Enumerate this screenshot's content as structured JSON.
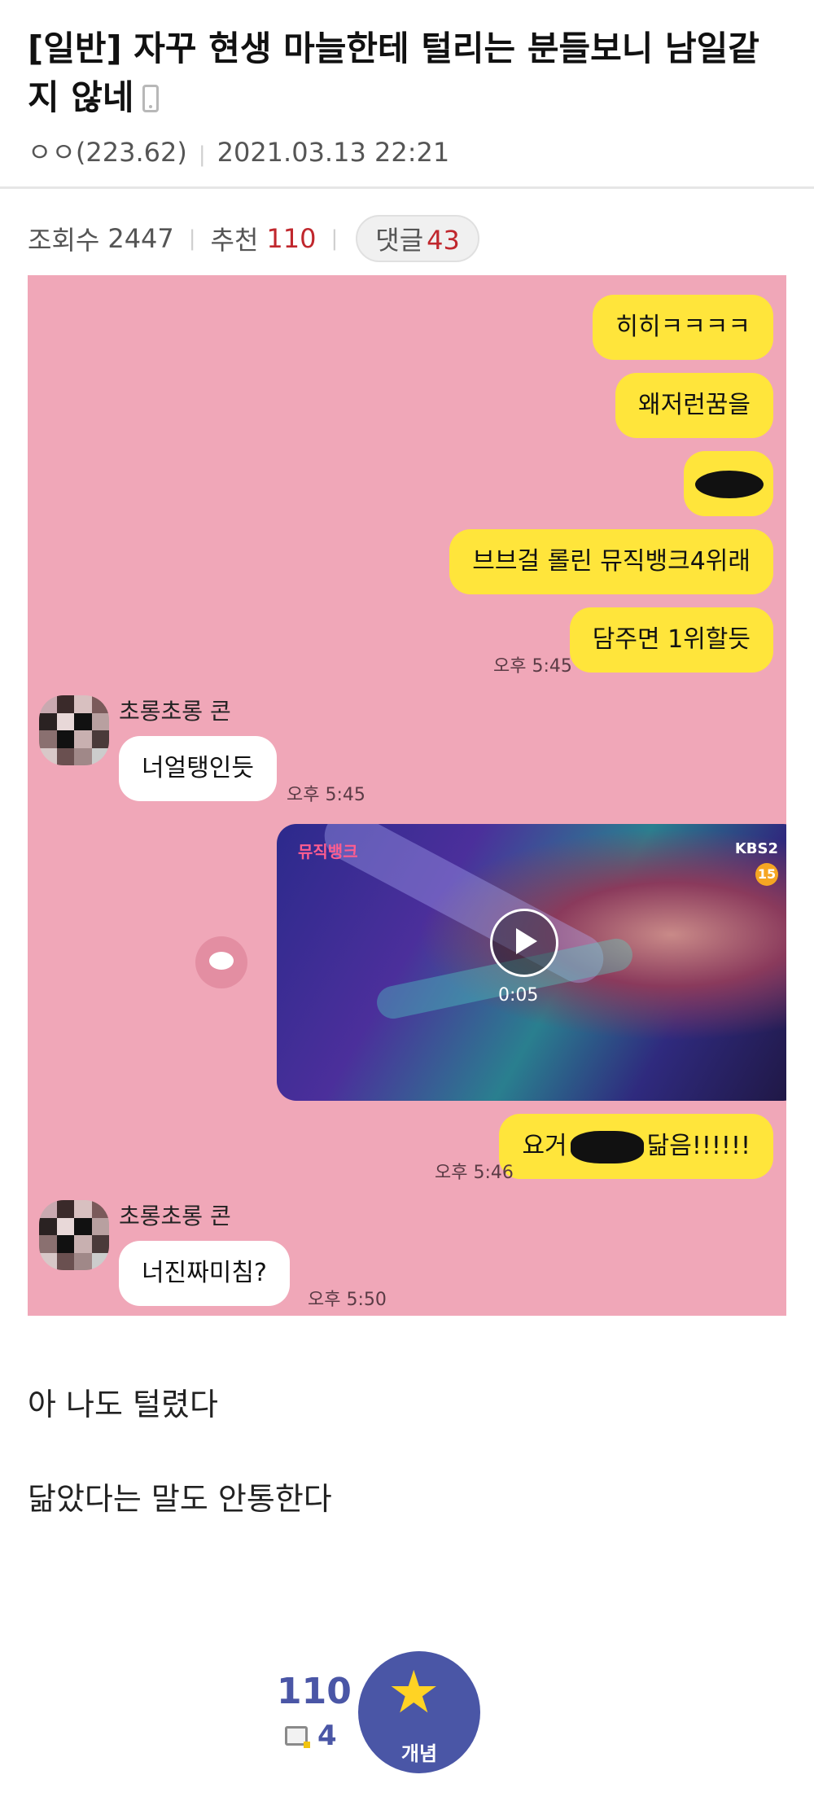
{
  "post": {
    "title": "[일반] 자꾸 현생 마늘한테 털리는 분들보니 남일같지 않네",
    "author": "ㅇㅇ(223.62)",
    "datetime": "2021.03.13 22:21",
    "views_label": "조회수",
    "views": "2447",
    "recommend_label": "추천",
    "recommend": "110",
    "comments_label": "댓글",
    "comments": "43"
  },
  "chat": {
    "sent": [
      {
        "text": "히히ㅋㅋㅋㅋ"
      },
      {
        "text": "왜저런꿈을"
      },
      {
        "text": ""
      },
      {
        "text": "브브걸 롤린 뮤직뱅크4위래"
      },
      {
        "text": "담주면 1위할듯"
      }
    ],
    "time1": "오후 5:45",
    "sender_name": "초롱초롱 콘",
    "recv1": "너얼탱인듯",
    "time2": "오후 5:45",
    "video_duration": "0:05",
    "video_channel": "KBS2",
    "video_rating": "15",
    "video_logo": "뮤직뱅크",
    "sent2_prefix": "요거",
    "sent2_suffix": "닮음!!!!!!",
    "time3": "오후 5:46",
    "sender_name2": "초롱초롱 콘",
    "recv2": "너진짜미침?",
    "time4": "오후 5:50"
  },
  "body": {
    "line1": "아 나도 털렸다",
    "line2": "닮았다는 말도 안통한다"
  },
  "footer": {
    "recommend_count": "110",
    "comment_count": "4",
    "gaenyeom_label": "개념"
  },
  "colors": {
    "chat_background": "#f0a7b8",
    "sent_bubble": "#ffe53b",
    "received_bubble": "#ffffff",
    "accent_red": "#c0272d",
    "gaenyeom_blue": "#4a56a6"
  }
}
